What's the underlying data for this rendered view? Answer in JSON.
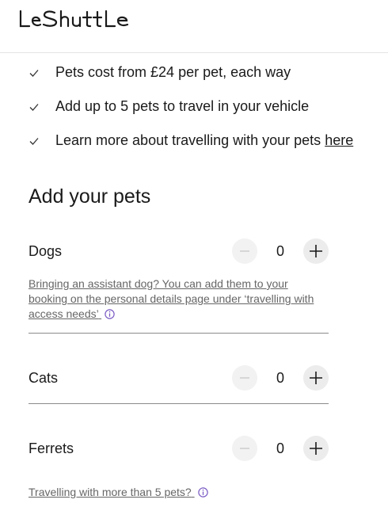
{
  "brand": {
    "logo_text": "LeShuttle"
  },
  "benefits": [
    {
      "text": "Pets cost from £24 per pet, each way",
      "link": ""
    },
    {
      "text": "Add up to 5 pets to travel in your vehicle",
      "link": ""
    },
    {
      "text": "Learn more about travelling with your pets",
      "link": "here"
    }
  ],
  "section": {
    "title": "Add your pets"
  },
  "pets": [
    {
      "label": "Dogs",
      "count": "0"
    },
    {
      "label": "Cats",
      "count": "0"
    },
    {
      "label": "Ferrets",
      "count": "0"
    }
  ],
  "assistant_note": "Bringing an assistant dog? You can add them to your booking on the personal details page under ‘travelling with access needs’",
  "more_pets_link": "Travelling with more than 5 pets?",
  "colors": {
    "info_accent": "#7b5cc4",
    "button_bg": "#ececec",
    "divider": "#8a8a8a"
  },
  "icons": {
    "benefit": "check-icon",
    "info": "info-icon",
    "decrement": "minus-icon",
    "increment": "plus-icon"
  }
}
